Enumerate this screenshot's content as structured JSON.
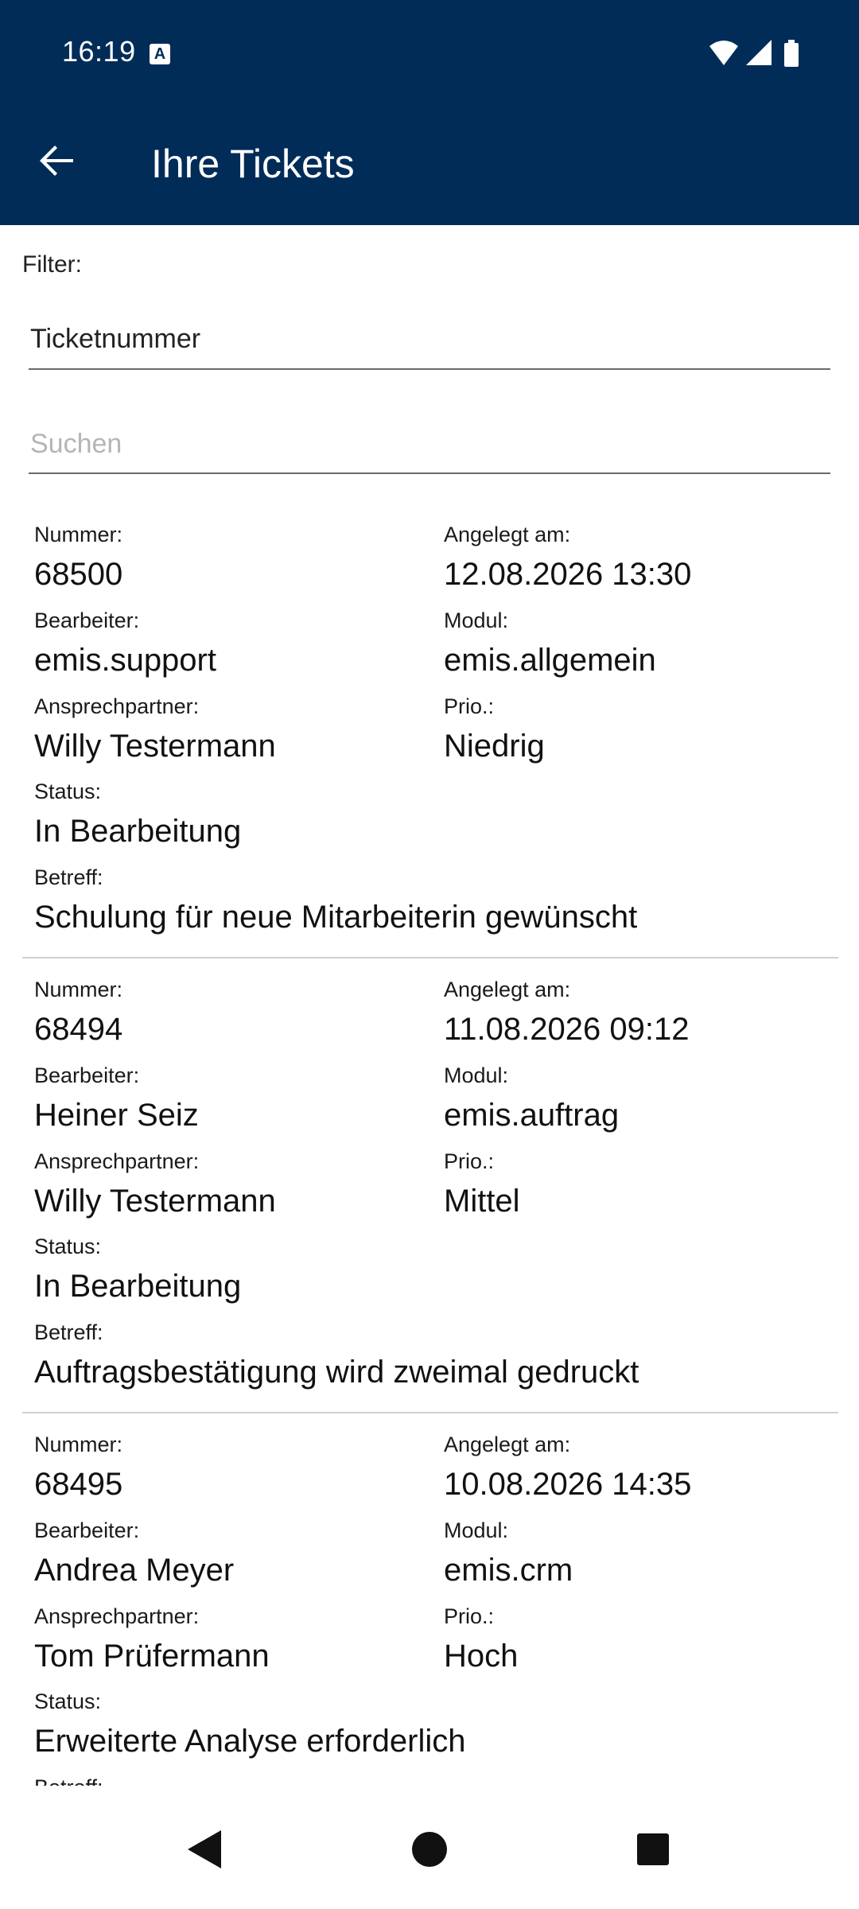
{
  "status_bar": {
    "time": "16:19",
    "notification_badge": "A"
  },
  "app_bar": {
    "title": "Ihre Tickets",
    "back_icon": "arrow-left-icon"
  },
  "filter": {
    "label": "Filter:",
    "field_value": "Ticketnummer",
    "search_placeholder": "Suchen",
    "search_value": ""
  },
  "labels": {
    "nummer": "Nummer:",
    "angelegt": "Angelegt am:",
    "bearbeiter": "Bearbeiter:",
    "modul": "Modul:",
    "ansprechpartner": "Ansprechpartner:",
    "prio": "Prio.:",
    "status": "Status:",
    "betreff": "Betreff:"
  },
  "tickets": [
    {
      "nummer": "68500",
      "angelegt": "12.08.2026 13:30",
      "bearbeiter": "emis.support",
      "modul": "emis.allgemein",
      "ansprechpartner": "Willy Testermann",
      "prio": "Niedrig",
      "status": "In Bearbeitung",
      "betreff": "Schulung für neue Mitarbeiterin gewünscht"
    },
    {
      "nummer": "68494",
      "angelegt": "11.08.2026 09:12",
      "bearbeiter": "Heiner Seiz",
      "modul": "emis.auftrag",
      "ansprechpartner": "Willy Testermann",
      "prio": "Mittel",
      "status": "In Bearbeitung",
      "betreff": "Auftragsbestätigung wird zweimal gedruckt"
    },
    {
      "nummer": "68495",
      "angelegt": "10.08.2026 14:35",
      "bearbeiter": "Andrea Meyer",
      "modul": "emis.crm",
      "ansprechpartner": "Tom Prüfermann",
      "prio": "Hoch",
      "status": "Erweiterte Analyse erforderlich",
      "betreff": ""
    }
  ],
  "colors": {
    "primary": "#022c58",
    "divider": "#d0d0d0",
    "placeholder": "#b5b5b5"
  }
}
